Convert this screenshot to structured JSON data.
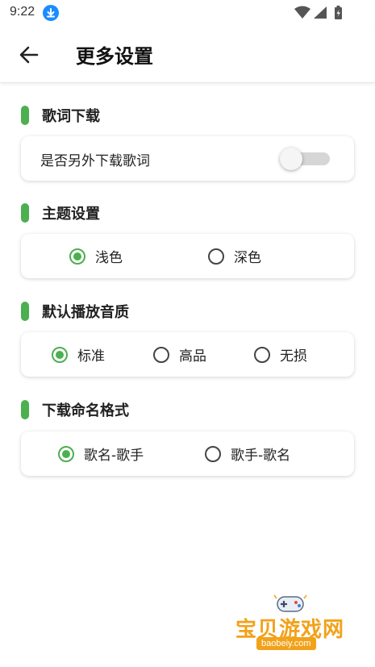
{
  "status_bar": {
    "time": "9:22"
  },
  "header": {
    "title": "更多设置"
  },
  "sections": {
    "lyrics": {
      "title": "歌词下载",
      "option_label": "是否另外下载歌词",
      "toggle_on": false
    },
    "theme": {
      "title": "主题设置",
      "options": [
        "浅色",
        "深色"
      ],
      "selected": "浅色"
    },
    "quality": {
      "title": "默认播放音质",
      "options": [
        "标准",
        "高品",
        "无损"
      ],
      "selected": "标准"
    },
    "naming": {
      "title": "下载命名格式",
      "options": [
        "歌名-歌手",
        "歌手-歌名"
      ],
      "selected": "歌名-歌手"
    }
  },
  "watermark": {
    "name": "宝贝游戏网",
    "url": "baobeiy.com"
  },
  "colors": {
    "accent": "#4caf50",
    "watermark": "#f2a21a"
  }
}
